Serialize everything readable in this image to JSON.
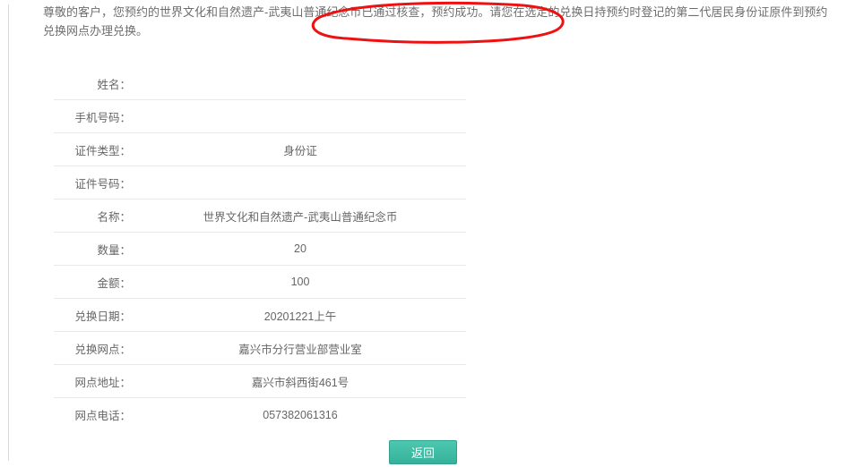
{
  "notice": {
    "full_text": "尊敬的客户，您预约的世界文化和自然遗产-武夷山普通纪念币已通过核查，预约成功。请您在选定的兑换日持预约时登记的第二代居民身份证原件到预约兑换网点办理兑换。"
  },
  "fields": {
    "name_label": "姓名：",
    "name_value": "",
    "phone_label": "手机号码：",
    "phone_value": "",
    "idtype_label": "证件类型：",
    "idtype_value": "身份证",
    "idno_label": "证件号码：",
    "idno_value": "",
    "product_label": "名称：",
    "product_value": "世界文化和自然遗产-武夷山普通纪念币",
    "qty_label": "数量：",
    "qty_value": "20",
    "amount_label": "金额：",
    "amount_value": "100",
    "exdate_label": "兑换日期：",
    "exdate_value": "20201221上午",
    "branch_label": "兑换网点：",
    "branch_value": "嘉兴市分行营业部营业室",
    "addr_label": "网点地址：",
    "addr_value": "嘉兴市斜西街461号",
    "tel_label": "网点电话：",
    "tel_value": "057382061316"
  },
  "buttons": {
    "return_label": "返回"
  },
  "annotation": {
    "color": "#e11",
    "highlighted_text": "武夷山普通纪念币已通过核查，预约成功。"
  }
}
